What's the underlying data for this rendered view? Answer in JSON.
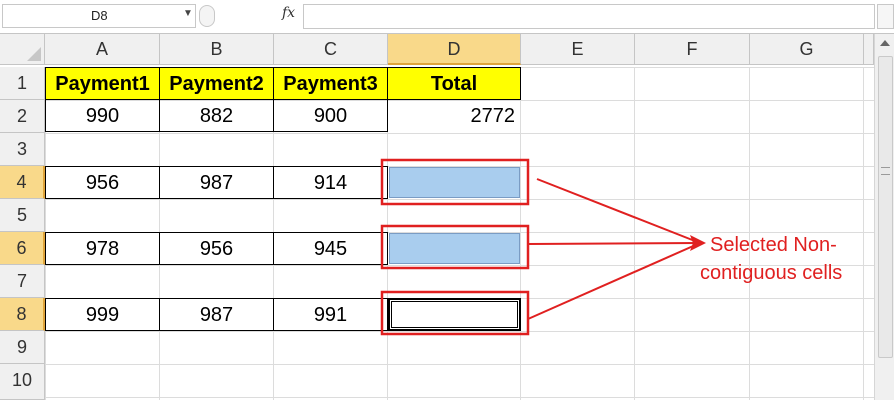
{
  "formula_bar": {
    "name_box": "D8",
    "name_box_arrow": "▼",
    "fx_label": "fx",
    "formula": ""
  },
  "columns": [
    "A",
    "B",
    "C",
    "D",
    "E",
    "F",
    "G"
  ],
  "selected_column": "D",
  "rows": [
    "1",
    "2",
    "3",
    "4",
    "5",
    "6",
    "7",
    "8",
    "9",
    "10"
  ],
  "selected_rows": [
    "4",
    "6",
    "8"
  ],
  "sheet": {
    "headers": [
      "Payment1",
      "Payment2",
      "Payment3",
      "Total"
    ],
    "row2": [
      "990",
      "882",
      "900",
      "2772"
    ],
    "row4": [
      "956",
      "987",
      "914"
    ],
    "row6": [
      "978",
      "956",
      "945"
    ],
    "row8": [
      "999",
      "987",
      "991"
    ]
  },
  "annotation": {
    "text_line1": "Selected Non-",
    "text_line2": "contiguous cells",
    "color": "#e02020"
  },
  "colors": {
    "header_fill": "#ffff00",
    "selection_fill": "#a9cdee",
    "header_highlight": "#f9d98a"
  }
}
